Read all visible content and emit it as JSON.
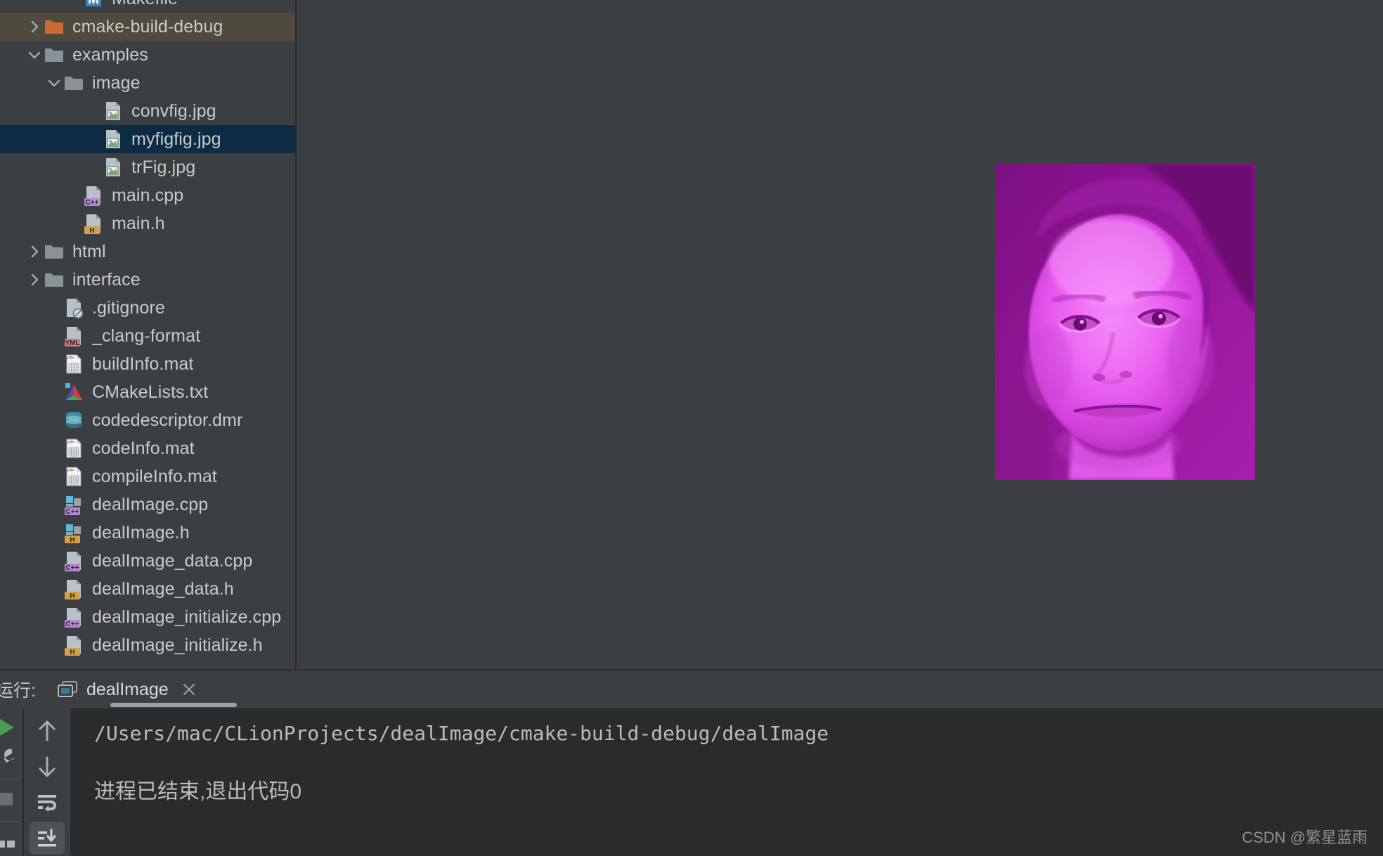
{
  "colors": {
    "background": "#3c3f41",
    "console_background": "#2b2b2b",
    "selection_blue": "#0d2c44",
    "selection_olive": "#4e4a3d",
    "text": "#c8cbcd",
    "folder_orange": "#cd6a33",
    "folder_gray": "#8a9199",
    "run_green": "#499c54",
    "image_tint_magenta": "#e65ff0",
    "image_tint_dark": "#7d0f82"
  },
  "project_tree": {
    "name": "Project",
    "items": [
      {
        "label": "Makefile",
        "indent": 3,
        "arrow": "none",
        "icon": "makefile-icon",
        "state": "clipped"
      },
      {
        "label": "cmake-build-debug",
        "indent": 1,
        "arrow": "collapsed",
        "icon": "folder-orange-icon",
        "state": "olive"
      },
      {
        "label": "examples",
        "indent": 1,
        "arrow": "expanded",
        "icon": "folder-icon",
        "state": "normal"
      },
      {
        "label": "image",
        "indent": 2,
        "arrow": "expanded",
        "icon": "folder-icon",
        "state": "normal"
      },
      {
        "label": "convfig.jpg",
        "indent": 4,
        "arrow": "none",
        "icon": "image-file-icon",
        "state": "normal"
      },
      {
        "label": "myfigfig.jpg",
        "indent": 4,
        "arrow": "none",
        "icon": "image-file-icon",
        "state": "selected"
      },
      {
        "label": "trFig.jpg",
        "indent": 4,
        "arrow": "none",
        "icon": "image-file-icon",
        "state": "normal"
      },
      {
        "label": "main.cpp",
        "indent": 3,
        "arrow": "none",
        "icon": "cpp-file-icon",
        "state": "normal"
      },
      {
        "label": "main.h",
        "indent": 3,
        "arrow": "none",
        "icon": "h-file-icon",
        "state": "normal"
      },
      {
        "label": "html",
        "indent": 1,
        "arrow": "collapsed",
        "icon": "folder-icon",
        "state": "normal"
      },
      {
        "label": "interface",
        "indent": 1,
        "arrow": "collapsed",
        "icon": "folder-icon",
        "state": "normal"
      },
      {
        "label": ".gitignore",
        "indent": 2,
        "arrow": "none",
        "icon": "gitignore-icon",
        "state": "normal"
      },
      {
        "label": "_clang-format",
        "indent": 2,
        "arrow": "none",
        "icon": "yml-file-icon",
        "state": "normal"
      },
      {
        "label": "buildInfo.mat",
        "indent": 2,
        "arrow": "none",
        "icon": "mat-file-icon",
        "state": "normal"
      },
      {
        "label": "CMakeLists.txt",
        "indent": 2,
        "arrow": "none",
        "icon": "cmake-icon",
        "state": "normal"
      },
      {
        "label": "codedescriptor.dmr",
        "indent": 2,
        "arrow": "none",
        "icon": "database-icon",
        "state": "normal"
      },
      {
        "label": "codeInfo.mat",
        "indent": 2,
        "arrow": "none",
        "icon": "mat-file-icon",
        "state": "normal"
      },
      {
        "label": "compileInfo.mat",
        "indent": 2,
        "arrow": "none",
        "icon": "mat-file-icon",
        "state": "normal"
      },
      {
        "label": "dealImage.cpp",
        "indent": 2,
        "arrow": "none",
        "icon": "cpp-class-icon",
        "state": "normal"
      },
      {
        "label": "dealImage.h",
        "indent": 2,
        "arrow": "none",
        "icon": "h-class-icon",
        "state": "normal"
      },
      {
        "label": "dealImage_data.cpp",
        "indent": 2,
        "arrow": "none",
        "icon": "cpp-file-icon",
        "state": "normal"
      },
      {
        "label": "dealImage_data.h",
        "indent": 2,
        "arrow": "none",
        "icon": "h-file-icon",
        "state": "normal"
      },
      {
        "label": "dealImage_initialize.cpp",
        "indent": 2,
        "arrow": "none",
        "icon": "cpp-file-icon",
        "state": "normal"
      },
      {
        "label": "dealImage_initialize.h",
        "indent": 2,
        "arrow": "none",
        "icon": "h-file-icon",
        "state": "normal"
      }
    ]
  },
  "viewer": {
    "open_file": "myfigfig.jpg",
    "image_description": "magenta-tinted portrait photograph"
  },
  "run_window": {
    "title": "运行:",
    "tab": {
      "label": "dealImage",
      "icon": "run-config-icon",
      "close_icon": "close-icon",
      "active": true
    },
    "left_toolbar": [
      {
        "name": "rerun-button",
        "icon": "play-icon"
      },
      {
        "name": "edit-configurations",
        "icon": "wrench-icon"
      },
      {
        "name": "stop-button",
        "icon": "stop-icon"
      },
      {
        "name": "pin-tab-button",
        "icon": "pin-icon"
      }
    ],
    "right_toolbar": [
      {
        "name": "up-the-stack-trace",
        "icon": "arrow-up-icon",
        "active": false
      },
      {
        "name": "down-the-stack-trace",
        "icon": "arrow-down-icon",
        "active": false
      },
      {
        "name": "soft-wrap-button",
        "icon": "soft-wrap-icon",
        "active": false
      },
      {
        "name": "scroll-to-end-button",
        "icon": "scroll-to-end-icon",
        "active": true
      }
    ],
    "console": {
      "command_path": "/Users/mac/CLionProjects/dealImage/cmake-build-debug/dealImage",
      "blank_line": "",
      "exit_message": "进程已结束,退出代码0"
    }
  },
  "watermark": "CSDN @繁星蓝雨"
}
